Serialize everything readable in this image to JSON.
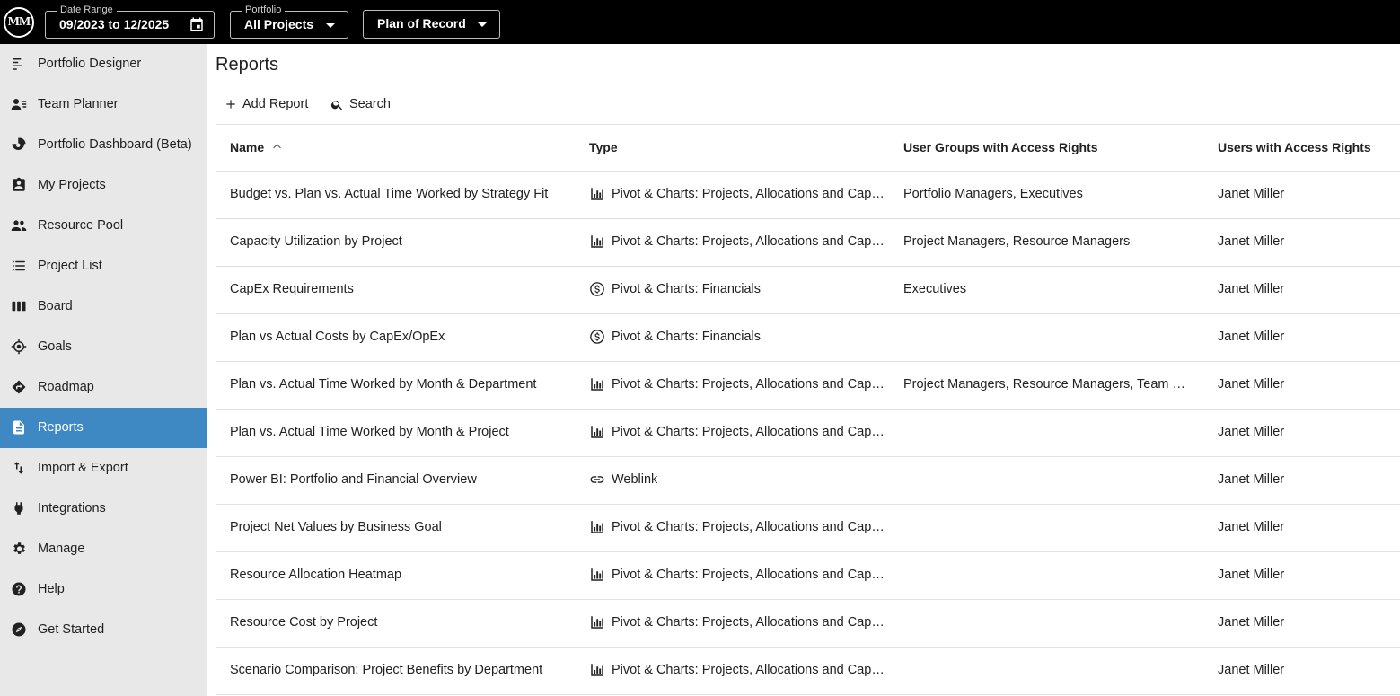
{
  "topbar": {
    "logo_text": "MM",
    "date_range": {
      "legend": "Date Range",
      "value": "09/2023 to 12/2025"
    },
    "portfolio": {
      "legend": "Portfolio",
      "value": "All Projects"
    },
    "scenario": {
      "value": "Plan of Record"
    }
  },
  "sidebar": {
    "items": [
      {
        "label": "Portfolio Designer",
        "icon": "portfolio-designer-icon"
      },
      {
        "label": "Team Planner",
        "icon": "team-planner-icon"
      },
      {
        "label": "Portfolio Dashboard (Beta)",
        "icon": "dashboard-icon"
      },
      {
        "label": "My Projects",
        "icon": "my-projects-icon"
      },
      {
        "label": "Resource Pool",
        "icon": "people-icon"
      },
      {
        "label": "Project List",
        "icon": "list-icon"
      },
      {
        "label": "Board",
        "icon": "board-icon"
      },
      {
        "label": "Goals",
        "icon": "target-icon"
      },
      {
        "label": "Roadmap",
        "icon": "roadmap-icon"
      },
      {
        "label": "Reports",
        "icon": "document-icon",
        "active": true
      },
      {
        "label": "Import & Export",
        "icon": "import-export-icon"
      },
      {
        "label": "Integrations",
        "icon": "plug-icon"
      },
      {
        "label": "Manage",
        "icon": "gear-icon"
      },
      {
        "label": "Help",
        "icon": "help-icon"
      },
      {
        "label": "Get Started",
        "icon": "compass-icon"
      }
    ]
  },
  "main": {
    "title": "Reports",
    "add_report_label": "Add Report",
    "search_label": "Search",
    "columns": {
      "name": "Name",
      "type": "Type",
      "groups": "User Groups with Access Rights",
      "users": "Users with Access Rights"
    },
    "rows": [
      {
        "name": "Budget vs. Plan vs. Actual Time Worked by Strategy Fit",
        "type": "Pivot & Charts: Projects, Allocations and Capa...",
        "type_icon": "bar-chart-icon",
        "groups": "Portfolio Managers, Executives",
        "users": "Janet Miller"
      },
      {
        "name": "Capacity Utilization by Project",
        "type": "Pivot & Charts: Projects, Allocations and Capa...",
        "type_icon": "bar-chart-icon",
        "groups": "Project Managers, Resource Managers",
        "users": "Janet Miller"
      },
      {
        "name": "CapEx Requirements",
        "type": "Pivot & Charts: Financials",
        "type_icon": "dollar-icon",
        "groups": "Executives",
        "users": "Janet Miller"
      },
      {
        "name": "Plan vs Actual Costs by CapEx/OpEx",
        "type": "Pivot & Charts: Financials",
        "type_icon": "dollar-icon",
        "groups": "",
        "users": "Janet Miller"
      },
      {
        "name": "Plan vs. Actual Time Worked by Month & Department",
        "type": "Pivot & Charts: Projects, Allocations and Capa...",
        "type_icon": "bar-chart-icon",
        "groups": "Project Managers, Resource Managers, Team Me...",
        "users": "Janet Miller"
      },
      {
        "name": "Plan vs. Actual Time Worked by Month & Project",
        "type": "Pivot & Charts: Projects, Allocations and Capa...",
        "type_icon": "bar-chart-icon",
        "groups": "",
        "users": "Janet Miller"
      },
      {
        "name": "Power BI: Portfolio and Financial Overview",
        "type": "Weblink",
        "type_icon": "link-icon",
        "groups": "",
        "users": "Janet Miller"
      },
      {
        "name": "Project Net Values by Business Goal",
        "type": "Pivot & Charts: Projects, Allocations and Capa...",
        "type_icon": "bar-chart-icon",
        "groups": "",
        "users": "Janet Miller"
      },
      {
        "name": "Resource Allocation Heatmap",
        "type": "Pivot & Charts: Projects, Allocations and Capa...",
        "type_icon": "bar-chart-icon",
        "groups": "",
        "users": "Janet Miller"
      },
      {
        "name": "Resource Cost by Project",
        "type": "Pivot & Charts: Projects, Allocations and Capa...",
        "type_icon": "bar-chart-icon",
        "groups": "",
        "users": "Janet Miller"
      },
      {
        "name": "Scenario Comparison: Project Benefits by Department",
        "type": "Pivot & Charts: Projects, Allocations and Capa...",
        "type_icon": "bar-chart-icon",
        "groups": "",
        "users": "Janet Miller"
      }
    ]
  }
}
